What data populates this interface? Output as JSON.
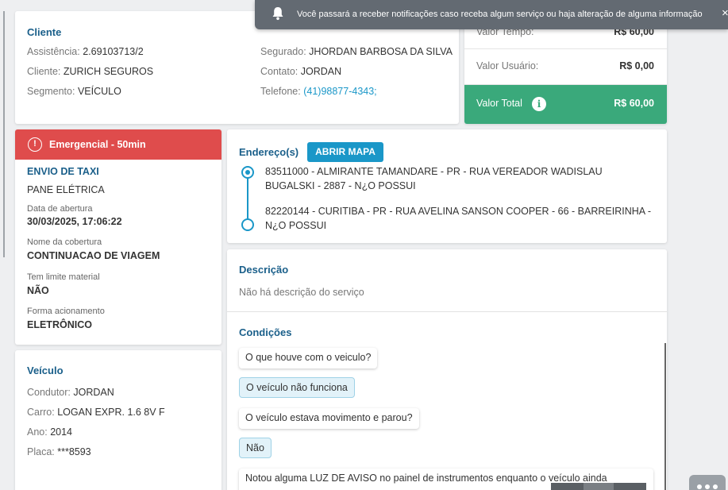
{
  "notification": {
    "text": "Você passará a receber notificações caso receba algum serviço ou haja alteração de alguma informação",
    "close": "×"
  },
  "cliente": {
    "title": "Cliente",
    "assistencia_label": "Assistência:",
    "assistencia_value": "2.69103713/2",
    "cliente_label": "Cliente:",
    "cliente_value": "ZURICH SEGUROS",
    "segmento_label": "Segmento:",
    "segmento_value": "VEÍCULO",
    "segurado_label": "Segurado:",
    "segurado_value": "JHORDAN BARBOSA DA SILVA",
    "contato_label": "Contato:",
    "contato_value": "JORDAN",
    "telefone_label": "Telefone:",
    "telefone_value": "(41)98877-4343;"
  },
  "valores": {
    "tempo_label": "Valor Tempo:",
    "tempo_value": "R$ 60,00",
    "usuario_label": "Valor Usuário:",
    "usuario_value": "R$ 0,00",
    "total_label": "Valor Total",
    "total_value": "R$ 60,00",
    "info_glyph": "i"
  },
  "servico": {
    "badge": "Emergencial - 50min",
    "badge_glyph": "!",
    "tipo": "ENVIO DE TAXI",
    "motivo": "PANE ELÉTRICA",
    "abertura_label": "Data de abertura",
    "abertura_value": "30/03/2025, 17:06:22",
    "cobertura_label": "Nome da cobertura",
    "cobertura_value": "CONTINUACAO DE VIAGEM",
    "limite_label": "Tem limite material",
    "limite_value": "NÃO",
    "acionamento_label": "Forma acionamento",
    "acionamento_value": "ELETRÔNICO"
  },
  "veiculo": {
    "title": "Veículo",
    "condutor_label": "Condutor:",
    "condutor_value": "JORDAN",
    "carro_label": "Carro:",
    "carro_value": "LOGAN EXPR. 1.6 8V F",
    "ano_label": "Ano:",
    "ano_value": "2014",
    "placa_label": "Placa:",
    "placa_value": "***8593"
  },
  "endereco": {
    "title": "Endereço(s)",
    "map_button": "ABRIR MAPA",
    "origem": "83511000 - ALMIRANTE TAMANDARE - PR - RUA VEREADOR WADISLAU BUGALSKI - 2887 - N¿O POSSUI",
    "destino": "82220144 - CURITIBA - PR - RUA AVELINA SANSON COOPER - 66 - BARREIRINHA - N¿O POSSUI"
  },
  "descricao": {
    "title": "Descrição",
    "text": "Não há descrição do serviço"
  },
  "condicoes": {
    "title": "Condições",
    "items": [
      {
        "type": "question",
        "text": "O que houve com o veiculo?"
      },
      {
        "type": "answer",
        "text": "O veículo não funciona"
      },
      {
        "type": "question",
        "text": "O veículo estava movimento e parou?"
      },
      {
        "type": "answer",
        "text": "Não"
      },
      {
        "type": "question",
        "text": "Notou alguma LUZ DE AVISO no painel de instrumentos enquanto o veículo ainda"
      }
    ]
  },
  "colors": {
    "primary": "#1a97c8",
    "title": "#1a5f8a",
    "success": "#3aa97b",
    "danger": "#df4c4c",
    "notification": "#636a72"
  },
  "icons": [
    "bell-icon",
    "info-icon",
    "alert-icon",
    "close-icon",
    "chat-icon"
  ]
}
